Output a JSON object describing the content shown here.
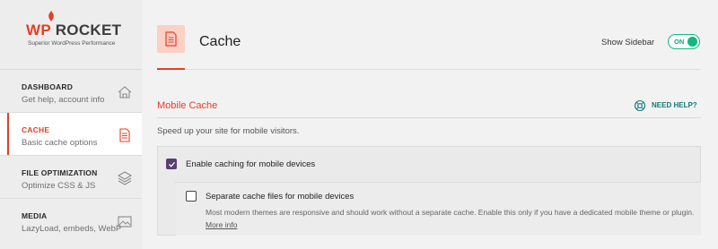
{
  "logo": {
    "brand_wp": "WP",
    "brand_rocket": "ROCKET",
    "tagline": "Superior WordPress Performance"
  },
  "sidebar": {
    "items": [
      {
        "title": "DASHBOARD",
        "subtitle": "Get help, account info",
        "icon": "home-icon",
        "active": false
      },
      {
        "title": "CACHE",
        "subtitle": "Basic cache options",
        "icon": "document-icon",
        "active": true
      },
      {
        "title": "FILE OPTIMIZATION",
        "subtitle": "Optimize CSS & JS",
        "icon": "layers-icon",
        "active": false
      },
      {
        "title": "MEDIA",
        "subtitle": "LazyLoad, embeds, WebP",
        "icon": "image-icon",
        "active": false
      }
    ]
  },
  "header": {
    "title": "Cache",
    "show_sidebar_label": "Show Sidebar",
    "toggle_state": "ON"
  },
  "section": {
    "title": "Mobile Cache",
    "help_label": "NEED HELP?",
    "description": "Speed up your site for mobile visitors."
  },
  "options": {
    "mobile_cache_label": "Enable caching for mobile devices",
    "mobile_cache_checked": true,
    "separate_files_label": "Separate cache files for mobile devices",
    "separate_files_checked": false,
    "separate_files_desc": "Most modern themes are responsive and should work without a separate cache. Enable this only if you have a dedicated mobile theme or plugin.",
    "more_info": "More info"
  },
  "colors": {
    "accent": "#e53e24",
    "toggle": "#10b981",
    "checkbox": "#5a3e73",
    "help": "#137a7a"
  }
}
